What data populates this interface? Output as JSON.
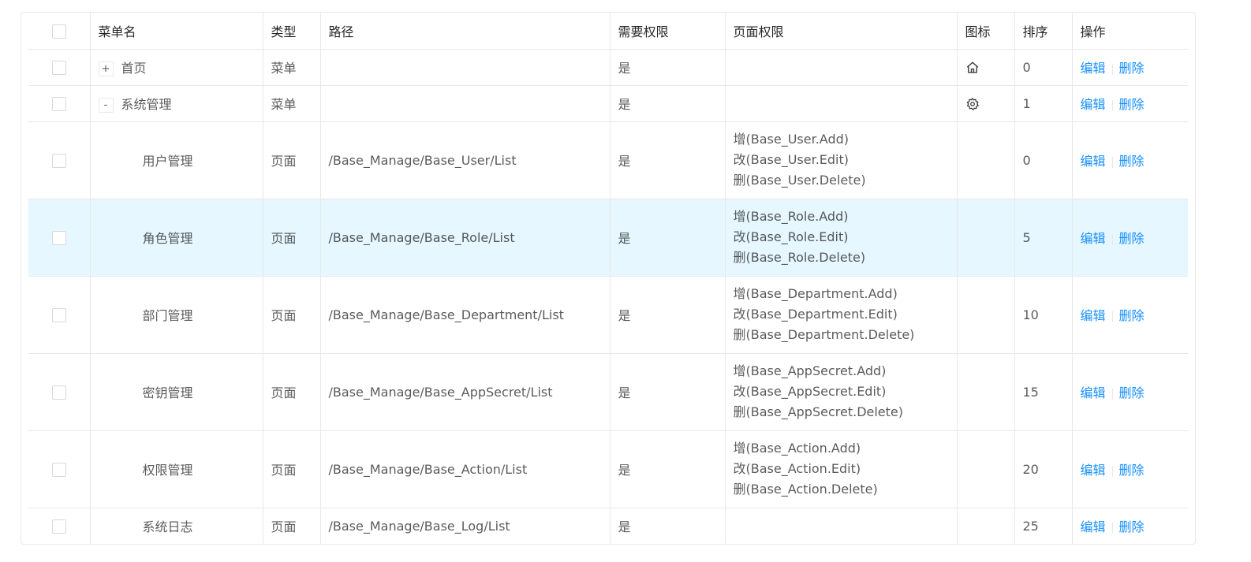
{
  "columns": {
    "menu_name": "菜单名",
    "type": "类型",
    "path": "路径",
    "need_permission": "需要权限",
    "page_permissions": "页面权限",
    "icon": "图标",
    "sort": "排序",
    "actions": "操作"
  },
  "actions": {
    "edit": "编辑",
    "delete": "删除"
  },
  "colors": {
    "link": "#1890ff",
    "highlight_row": "#e6f7ff",
    "border": "#e8e8e8"
  },
  "rows": [
    {
      "expand": "+",
      "name": "首页",
      "type": "菜单",
      "path": "",
      "need_permission": "是",
      "permissions": [],
      "icon": "home-icon",
      "sort": "0"
    },
    {
      "expand": "-",
      "name": "系统管理",
      "type": "菜单",
      "path": "",
      "need_permission": "是",
      "permissions": [],
      "icon": "setting-icon",
      "sort": "1"
    },
    {
      "name": "用户管理",
      "type": "页面",
      "path": "/Base_Manage/Base_User/List",
      "need_permission": "是",
      "permissions": [
        "增(Base_User.Add)",
        "改(Base_User.Edit)",
        "删(Base_User.Delete)"
      ],
      "sort": "0"
    },
    {
      "name": "角色管理",
      "type": "页面",
      "path": "/Base_Manage/Base_Role/List",
      "need_permission": "是",
      "permissions": [
        "增(Base_Role.Add)",
        "改(Base_Role.Edit)",
        "删(Base_Role.Delete)"
      ],
      "sort": "5"
    },
    {
      "name": "部门管理",
      "type": "页面",
      "path": "/Base_Manage/Base_Department/List",
      "need_permission": "是",
      "permissions": [
        "增(Base_Department.Add)",
        "改(Base_Department.Edit)",
        "删(Base_Department.Delete)"
      ],
      "sort": "10"
    },
    {
      "name": "密钥管理",
      "type": "页面",
      "path": "/Base_Manage/Base_AppSecret/List",
      "need_permission": "是",
      "permissions": [
        "增(Base_AppSecret.Add)",
        "改(Base_AppSecret.Edit)",
        "删(Base_AppSecret.Delete)"
      ],
      "sort": "15"
    },
    {
      "name": "权限管理",
      "type": "页面",
      "path": "/Base_Manage/Base_Action/List",
      "need_permission": "是",
      "permissions": [
        "增(Base_Action.Add)",
        "改(Base_Action.Edit)",
        "删(Base_Action.Delete)"
      ],
      "sort": "20"
    },
    {
      "name": "系统日志",
      "type": "页面",
      "path": "/Base_Manage/Base_Log/List",
      "need_permission": "是",
      "permissions": [],
      "sort": "25"
    }
  ]
}
